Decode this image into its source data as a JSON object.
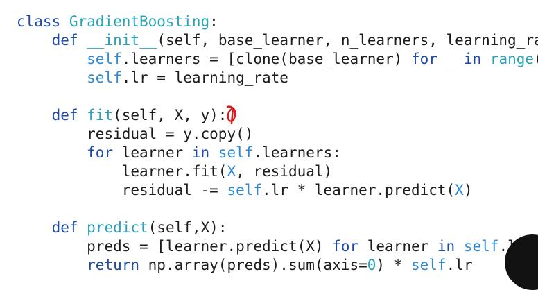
{
  "editor": {
    "colors": {
      "background": "#ffffff",
      "keyword": "#1f4aa8",
      "function_name": "#2aa1b8",
      "self": "#2f8ad6",
      "number": "#2aa1b8",
      "plain": "#1c1c1c",
      "annotation": "#d81b1b"
    },
    "annotation_icon": "red-pen-cursor-mark",
    "lines": [
      {
        "indent": 0,
        "tokens": [
          {
            "t": "kw",
            "v": "class "
          },
          {
            "t": "fn",
            "v": "GradientBoosting"
          },
          {
            "t": "plain",
            "v": ":"
          }
        ]
      },
      {
        "indent": 1,
        "tokens": [
          {
            "t": "kw",
            "v": "def "
          },
          {
            "t": "fn",
            "v": "__init__"
          },
          {
            "t": "plain",
            "v": "(self, base_learner, n_learners, learning_ra"
          }
        ]
      },
      {
        "indent": 2,
        "tokens": [
          {
            "t": "self",
            "v": "self"
          },
          {
            "t": "plain",
            "v": ".learners = [clone(base_learner) "
          },
          {
            "t": "kw",
            "v": "for"
          },
          {
            "t": "plain",
            "v": " _ "
          },
          {
            "t": "kw",
            "v": "in"
          },
          {
            "t": "plain",
            "v": " "
          },
          {
            "t": "fn",
            "v": "range"
          },
          {
            "t": "plain",
            "v": "("
          }
        ]
      },
      {
        "indent": 2,
        "tokens": [
          {
            "t": "self",
            "v": "self"
          },
          {
            "t": "plain",
            "v": ".lr = learning_rate"
          }
        ]
      },
      {
        "indent": 0,
        "tokens": []
      },
      {
        "indent": 1,
        "tokens": [
          {
            "t": "kw",
            "v": "def "
          },
          {
            "t": "fn",
            "v": "fit"
          },
          {
            "t": "plain",
            "v": "(self, X, y):"
          }
        ]
      },
      {
        "indent": 2,
        "tokens": [
          {
            "t": "plain",
            "v": "residual = y.copy()"
          }
        ]
      },
      {
        "indent": 2,
        "tokens": [
          {
            "t": "kw",
            "v": "for"
          },
          {
            "t": "plain",
            "v": " learner "
          },
          {
            "t": "kw",
            "v": "in"
          },
          {
            "t": "plain",
            "v": " "
          },
          {
            "t": "self",
            "v": "self"
          },
          {
            "t": "plain",
            "v": ".learners:"
          }
        ]
      },
      {
        "indent": 3,
        "tokens": [
          {
            "t": "plain",
            "v": "learner.fit("
          },
          {
            "t": "self",
            "v": "X"
          },
          {
            "t": "plain",
            "v": ", residual)"
          }
        ]
      },
      {
        "indent": 3,
        "tokens": [
          {
            "t": "plain",
            "v": "residual -= "
          },
          {
            "t": "self",
            "v": "self"
          },
          {
            "t": "plain",
            "v": ".lr * learner.predict("
          },
          {
            "t": "self",
            "v": "X"
          },
          {
            "t": "plain",
            "v": ")"
          }
        ]
      },
      {
        "indent": 0,
        "tokens": []
      },
      {
        "indent": 1,
        "tokens": [
          {
            "t": "kw",
            "v": "def "
          },
          {
            "t": "fn",
            "v": "predict"
          },
          {
            "t": "plain",
            "v": "(self,X):"
          }
        ]
      },
      {
        "indent": 2,
        "tokens": [
          {
            "t": "plain",
            "v": "preds = [learner.predict(X) "
          },
          {
            "t": "kw",
            "v": "for"
          },
          {
            "t": "plain",
            "v": " learner "
          },
          {
            "t": "kw",
            "v": "in"
          },
          {
            "t": "plain",
            "v": " "
          },
          {
            "t": "self",
            "v": "self"
          },
          {
            "t": "plain",
            "v": ".lea"
          }
        ]
      },
      {
        "indent": 2,
        "tokens": [
          {
            "t": "kw",
            "v": "return"
          },
          {
            "t": "plain",
            "v": " np.array(preds).sum(axis="
          },
          {
            "t": "num",
            "v": "0"
          },
          {
            "t": "plain",
            "v": ") * "
          },
          {
            "t": "self",
            "v": "self"
          },
          {
            "t": "plain",
            "v": ".lr"
          }
        ]
      }
    ]
  }
}
